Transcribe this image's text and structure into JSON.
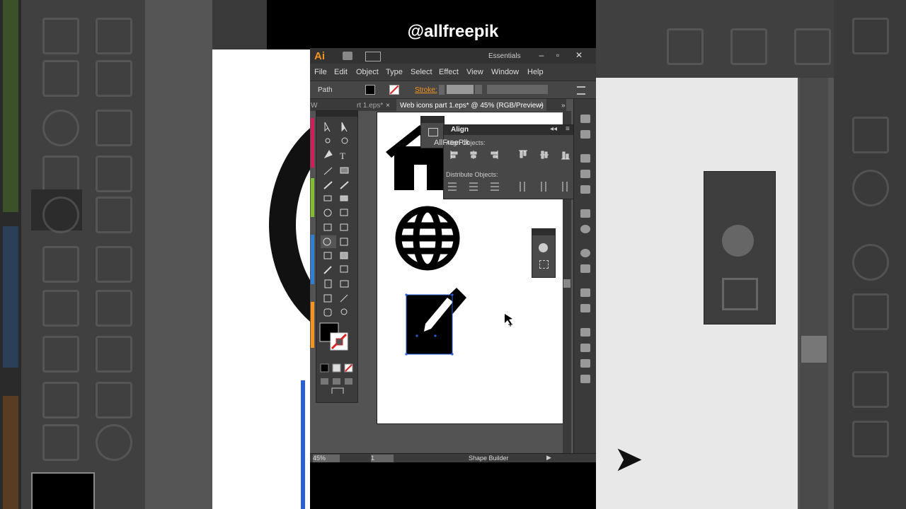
{
  "watermark": "@allfreepik",
  "app": {
    "logo": "Ai",
    "workspace": "Essentials",
    "window_controls": [
      "–",
      "▫",
      "✕"
    ]
  },
  "menu": [
    "File",
    "Edit",
    "Object",
    "Type",
    "Select",
    "Effect",
    "View",
    "Window",
    "Help"
  ],
  "control_bar": {
    "selection_type": "Path",
    "stroke_label": "Stroke:"
  },
  "tabs": {
    "inactive": "rt 1.eps*",
    "inactive_left": "W",
    "active": "Web icons part 1.eps* @ 45% (RGB/Preview)"
  },
  "align_panel": {
    "title": "Align",
    "align_objects_label": "Align Objects:",
    "distribute_objects_label": "Distribute Objects:",
    "overlay_text": "AllFreePik"
  },
  "status": {
    "zoom": "45%",
    "page": "1",
    "tool_name": "Shape Builder"
  },
  "artwork": {
    "icons": [
      "home-icon",
      "globe-icon",
      "edit-icon"
    ]
  },
  "colors": {
    "accent": "#f7941e",
    "selection": "#2b5fd9"
  }
}
